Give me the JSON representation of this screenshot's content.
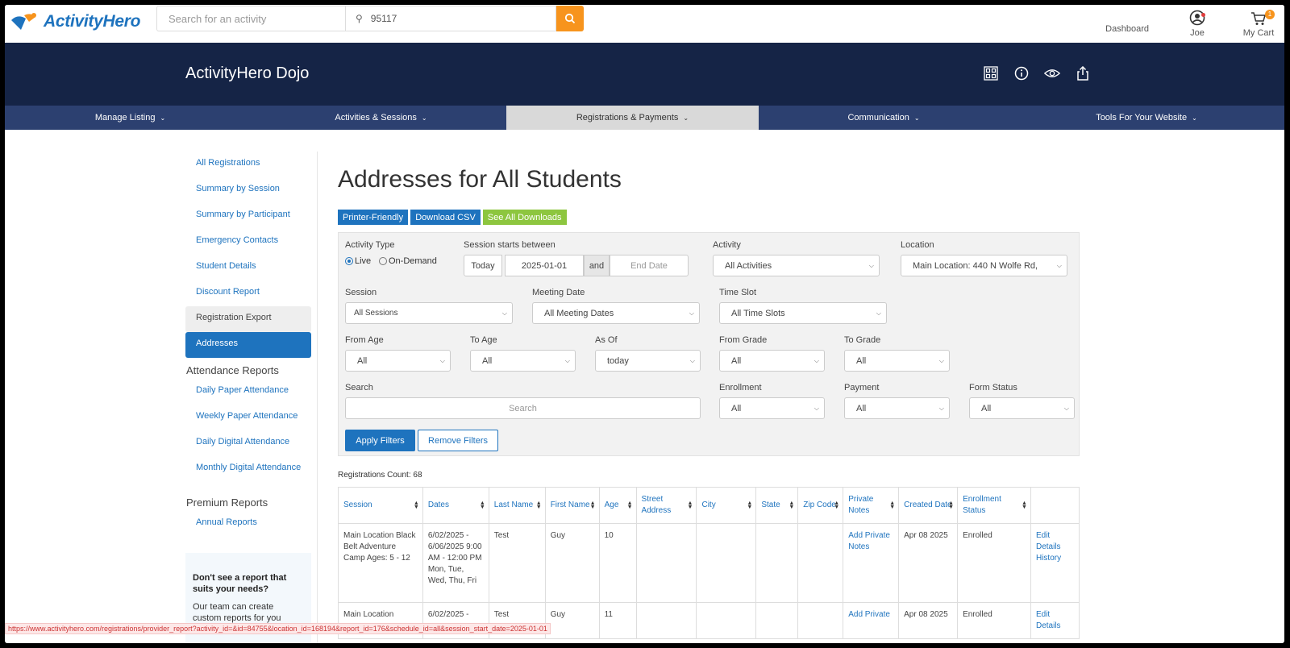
{
  "topbar": {
    "logo_text": "ActivityHero",
    "search_placeholder": "Search for an activity",
    "location_value": "95117",
    "dashboard": "Dashboard",
    "user": "Joe",
    "cart": "My Cart",
    "cart_count": "1"
  },
  "header": {
    "business_name": "ActivityHero Dojo"
  },
  "mainnav": {
    "tabs": [
      {
        "label": "Manage Listing"
      },
      {
        "label": "Activities & Sessions"
      },
      {
        "label": "Registrations & Payments"
      },
      {
        "label": "Communication"
      },
      {
        "label": "Tools For Your Website"
      }
    ]
  },
  "sidebar": {
    "links": [
      "All Registrations",
      "Summary by Session",
      "Summary by Participant",
      "Emergency Contacts",
      "Student Details",
      "Discount Report",
      "Registration Export",
      "Addresses"
    ],
    "attendance_heading": "Attendance Reports",
    "attendance_links": [
      "Daily Paper Attendance",
      "Weekly Paper Attendance",
      "Daily Digital Attendance",
      "Monthly Digital Attendance"
    ],
    "premium_heading": "Premium Reports",
    "premium_links": [
      "Annual Reports"
    ],
    "help_title": "Don't see a report that suits your needs?",
    "help_text": "Our team can create custom reports for you"
  },
  "main": {
    "title": "Addresses for All Students",
    "actions": {
      "printer": "Printer-Friendly",
      "csv": "Download CSV",
      "downloads": "See All Downloads"
    }
  },
  "filters": {
    "activity_type_label": "Activity Type",
    "live": "Live",
    "on_demand": "On-Demand",
    "session_between_label": "Session starts between",
    "today_btn": "Today",
    "start_date": "2025-01-01",
    "and": "and",
    "end_date_placeholder": "End Date",
    "activity_label": "Activity",
    "activity_value": "All Activities",
    "location_label": "Location",
    "location_value": "Main Location: 440 N Wolfe Rd,",
    "session_label": "Session",
    "session_value": "All Sessions",
    "meeting_date_label": "Meeting Date",
    "meeting_date_value": "All Meeting Dates",
    "time_slot_label": "Time Slot",
    "time_slot_value": "All Time Slots",
    "from_age_label": "From Age",
    "from_age_value": "All",
    "to_age_label": "To Age",
    "to_age_value": "All",
    "as_of_label": "As Of",
    "as_of_value": "today",
    "from_grade_label": "From Grade",
    "from_grade_value": "All",
    "to_grade_label": "To Grade",
    "to_grade_value": "All",
    "search_label": "Search",
    "search_placeholder": "Search",
    "enrollment_label": "Enrollment",
    "enrollment_value": "All",
    "payment_label": "Payment",
    "payment_value": "All",
    "form_status_label": "Form Status",
    "form_status_value": "All",
    "apply": "Apply Filters",
    "remove": "Remove Filters"
  },
  "table": {
    "count_text": "Registrations Count: 68",
    "headers": [
      "Session",
      "Dates",
      "Last Name",
      "First Name",
      "Age",
      "Street Address",
      "City",
      "State",
      "Zip Code",
      "Private Notes",
      "Created Date",
      "Enrollment Status",
      ""
    ],
    "rows": [
      {
        "session": "Main Location Black Belt Adventure Camp Ages: 5 - 12",
        "dates": "6/02/2025 - 6/06/2025 9:00 AM - 12:00 PM Mon, Tue, Wed, Thu, Fri",
        "last": "Test",
        "first": "Guy",
        "age": "10",
        "street": "",
        "city": "",
        "state": "",
        "zip": "",
        "notes": "Add Private Notes",
        "created": "Apr 08 2025",
        "status": "Enrolled",
        "actions": "Edit Details History"
      },
      {
        "session": "Main Location",
        "dates": "6/02/2025 -",
        "last": "Test",
        "first": "Guy",
        "age": "11",
        "street": "",
        "city": "",
        "state": "",
        "zip": "",
        "notes": "Add Private",
        "created": "Apr 08 2025",
        "status": "Enrolled",
        "actions": "Edit Details"
      }
    ]
  },
  "status_url": "https://www.activityhero.com/registrations/provider_report?activity_id=&id=84755&location_id=168194&report_id=176&schedule_id=all&session_start_date=2025-01-01",
  "colors": {
    "brand_blue": "#1e73be",
    "header_navy": "#152446",
    "nav_blue": "#2c4070",
    "accent_orange": "#f7941d",
    "green": "#8dc63f"
  }
}
